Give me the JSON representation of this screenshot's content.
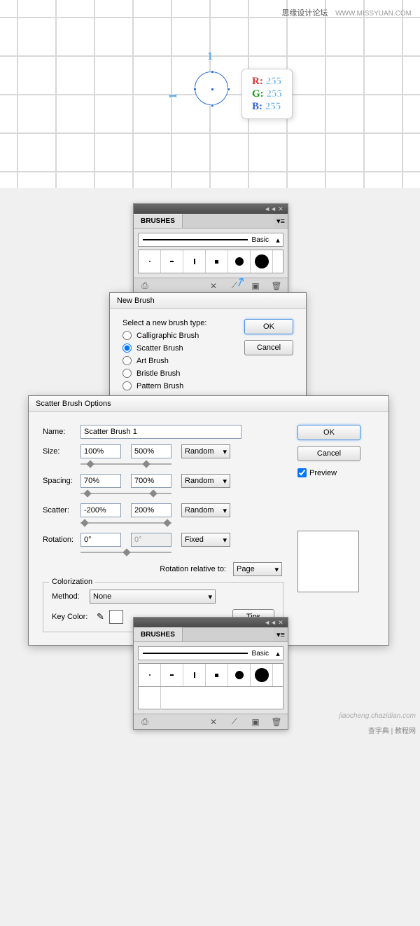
{
  "watermarks": {
    "top_chinese": "思缘设计论坛",
    "top_url": "WWW.MISSYUAN.COM",
    "bottom1": "jiaocheng.chazidian.com",
    "bottom2": "查字典 | 教程网"
  },
  "canvas": {
    "dim_top": "1",
    "dim_left": "1",
    "rgb": {
      "r_label": "R:",
      "g_label": "G:",
      "b_label": "B:",
      "r": "255",
      "g": "255",
      "b": "255"
    }
  },
  "brushes_panel": {
    "tab": "BRUSHES",
    "basic": "Basic"
  },
  "new_brush": {
    "title": "New Brush",
    "prompt": "Select a new brush type:",
    "opts": {
      "calligraphic": "Calligraphic Brush",
      "scatter": "Scatter Brush",
      "art": "Art Brush",
      "bristle": "Bristle Brush",
      "pattern": "Pattern Brush"
    },
    "ok": "OK",
    "cancel": "Cancel"
  },
  "scatter": {
    "title": "Scatter Brush Options",
    "name_label": "Name:",
    "name_value": "Scatter Brush 1",
    "size_label": "Size:",
    "size_a": "100%",
    "size_b": "500%",
    "size_mode": "Random",
    "spacing_label": "Spacing:",
    "spacing_a": "70%",
    "spacing_b": "700%",
    "spacing_mode": "Random",
    "scatter_label": "Scatter:",
    "scatter_a": "-200%",
    "scatter_b": "200%",
    "scatter_mode": "Random",
    "rotation_label": "Rotation:",
    "rotation_a": "0°",
    "rotation_b": "0°",
    "rotation_mode": "Fixed",
    "rel_label": "Rotation relative to:",
    "rel_value": "Page",
    "colorization": "Colorization",
    "method_label": "Method:",
    "method_value": "None",
    "keycolor_label": "Key Color:",
    "tips": "Tips",
    "ok": "OK",
    "cancel": "Cancel",
    "preview": "Preview"
  }
}
